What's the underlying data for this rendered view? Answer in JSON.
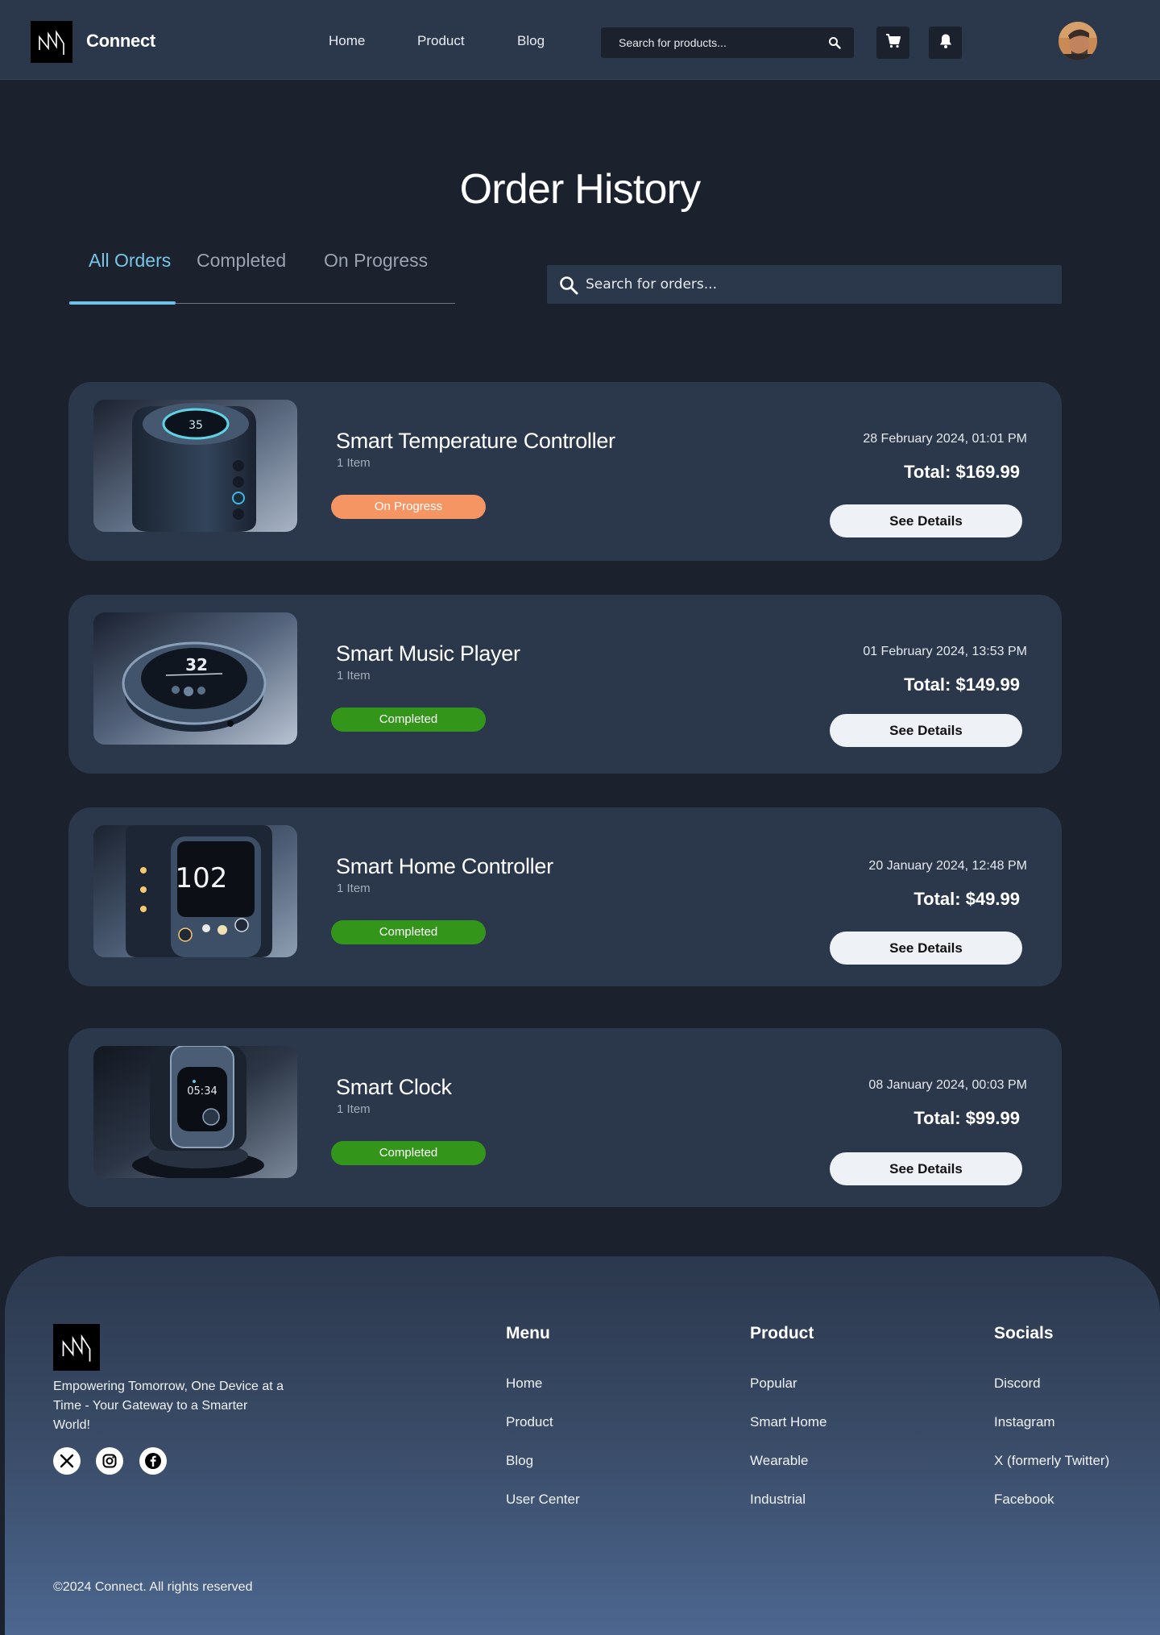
{
  "nav": {
    "brand": "Connect",
    "links": [
      "Home",
      "Product",
      "Blog"
    ],
    "search_placeholder": "Search for products..."
  },
  "page": {
    "title": "Order History",
    "tabs": [
      "All Orders",
      "Completed",
      "On Progress"
    ],
    "active_tab": "All Orders",
    "order_search_placeholder": "Search for orders..."
  },
  "orders": [
    {
      "name": "Smart Temperature Controller",
      "qty": "1 Item",
      "status": "On Progress",
      "date": "28 February 2024, 01:01 PM",
      "total": "Total: $169.99",
      "button": "See Details"
    },
    {
      "name": "Smart Music Player",
      "qty": "1 Item",
      "status": "Completed",
      "date": "01 February 2024, 13:53 PM",
      "total": "Total: $149.99",
      "button": "See Details"
    },
    {
      "name": "Smart Home Controller",
      "qty": "1 Item",
      "status": "Completed",
      "date": "20 January 2024, 12:48 PM",
      "total": "Total: $49.99",
      "button": "See Details"
    },
    {
      "name": "Smart Clock",
      "qty": "1 Item",
      "status": "Completed",
      "date": "08 January 2024, 00:03 PM",
      "total": "Total: $99.99",
      "button": "See Details"
    }
  ],
  "thumb_text": {
    "temp": "35",
    "music": "32",
    "home": "102",
    "clock": "05:34"
  },
  "footer": {
    "tagline": "Empowering Tomorrow, One Device at a Time - Your Gateway to a Smarter World!",
    "columns": [
      {
        "title": "Menu",
        "links": [
          "Home",
          "Product",
          "Blog",
          "User Center"
        ]
      },
      {
        "title": "Product",
        "links": [
          "Popular",
          "Smart Home",
          "Wearable",
          "Industrial"
        ]
      },
      {
        "title": "Socials",
        "links": [
          "Discord",
          "Instagram",
          "X (formerly Twitter)",
          "Facebook"
        ]
      }
    ],
    "copyright": "©2024 Connect. All rights reserved"
  },
  "colors": {
    "background": "#1b212d",
    "surface": "#2b384c",
    "accent": "#78c6e6",
    "status_progress": "#f49563",
    "status_completed": "#33961b"
  },
  "icons": [
    "logo-icon",
    "search-icon",
    "cart-icon",
    "bell-icon",
    "x-icon",
    "instagram-icon",
    "facebook-icon"
  ]
}
